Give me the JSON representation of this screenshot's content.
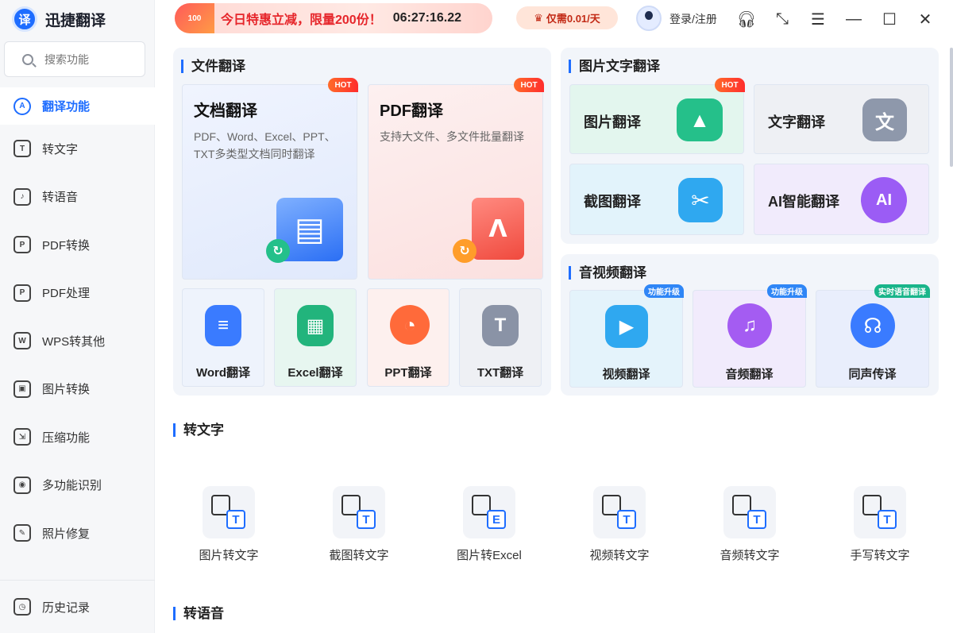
{
  "app": {
    "name": "迅捷翻译",
    "logo_char": "译"
  },
  "search": {
    "placeholder": "搜索功能"
  },
  "nav": [
    {
      "label": "翻译功能",
      "icon": "translate-icon",
      "glyph": "A"
    },
    {
      "label": "转文字",
      "icon": "to-text-icon",
      "glyph": "T"
    },
    {
      "label": "转语音",
      "icon": "to-speech-icon",
      "glyph": "♪"
    },
    {
      "label": "PDF转换",
      "icon": "pdf-convert-icon",
      "glyph": "P"
    },
    {
      "label": "PDF处理",
      "icon": "pdf-process-icon",
      "glyph": "P"
    },
    {
      "label": "WPS转其他",
      "icon": "wps-convert-icon",
      "glyph": "W"
    },
    {
      "label": "图片转换",
      "icon": "image-convert-icon",
      "glyph": "▣"
    },
    {
      "label": "压缩功能",
      "icon": "compress-icon",
      "glyph": "⇲"
    },
    {
      "label": "多功能识别",
      "icon": "recognize-icon",
      "glyph": "◉"
    },
    {
      "label": "照片修复",
      "icon": "photo-repair-icon",
      "glyph": "✎"
    }
  ],
  "history": {
    "label": "历史记录",
    "icon": "history-icon"
  },
  "topbar": {
    "promo_badge": "100",
    "promo_text": "今日特惠立减，限量200份！",
    "promo_time": "06:27:16.22",
    "price_text": "仅需0.01/天",
    "login_text": "登录/注册"
  },
  "doc_section": {
    "title": "文件翻译",
    "hot": "HOT",
    "doc_card": {
      "title": "文档翻译",
      "desc": "PDF、Word、Excel、PPT、TXT多类型文档同时翻译"
    },
    "pdf_card": {
      "title": "PDF翻译",
      "desc": "支持大文件、多文件批量翻译"
    },
    "small": [
      {
        "label": "Word翻译",
        "glyph": "≡",
        "color": "#3a7bff"
      },
      {
        "label": "Excel翻译",
        "glyph": "▦",
        "color": "#22b47c"
      },
      {
        "label": "PPT翻译",
        "glyph": "◔",
        "color": "#ff6a3a"
      },
      {
        "label": "TXT翻译",
        "glyph": "T",
        "color": "#8a93a6"
      }
    ]
  },
  "image_section": {
    "title": "图片文字翻译",
    "hot": "HOT",
    "cards": [
      {
        "label": "图片翻译",
        "glyph": "▲",
        "color": "#25c08a",
        "bg": "#e3f6ee"
      },
      {
        "label": "文字翻译",
        "glyph": "文",
        "color": "#8e98ab",
        "bg": "#eef0f4"
      },
      {
        "label": "截图翻译",
        "glyph": "✂",
        "color": "#2fa8f0",
        "bg": "#e2f3fb"
      },
      {
        "label": "AI智能翻译",
        "glyph": "AI",
        "color": "#9b5cf5",
        "bg": "#f1ebfc"
      }
    ]
  },
  "av_section": {
    "title": "音视频翻译",
    "cards": [
      {
        "label": "视频翻译",
        "badge": "功能升级",
        "badge_color": "#2f86f6",
        "glyph": "▶",
        "color": "#2fa8f0",
        "bg": "#e4f3fb"
      },
      {
        "label": "音频翻译",
        "badge": "功能升级",
        "badge_color": "#2f86f6",
        "glyph": "♫",
        "color": "#a45cf2",
        "bg": "#f1ebfc"
      },
      {
        "label": "同声传译",
        "badge": "实时语音翻译",
        "badge_color": "#19b58a",
        "glyph": "☊",
        "color": "#3a7bff",
        "bg": "#e9eefc"
      }
    ]
  },
  "text_section": {
    "title": "转文字",
    "tools": [
      {
        "label": "图片转文字",
        "glyph": "T"
      },
      {
        "label": "截图转文字",
        "glyph": "T"
      },
      {
        "label": "图片转Excel",
        "glyph": "E"
      },
      {
        "label": "视频转文字",
        "glyph": "T"
      },
      {
        "label": "音频转文字",
        "glyph": "T"
      },
      {
        "label": "手写转文字",
        "glyph": "T"
      }
    ]
  },
  "speech_section": {
    "title": "转语音"
  }
}
